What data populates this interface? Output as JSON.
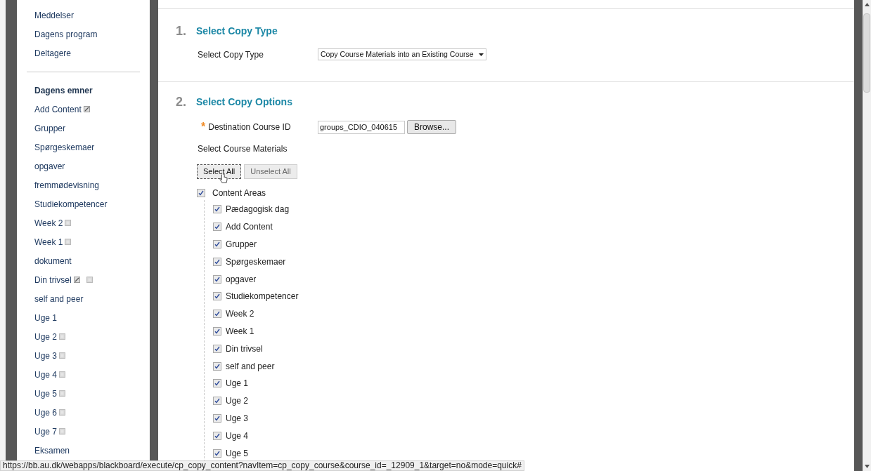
{
  "sidebar": {
    "top_items": [
      "Meddelser",
      "Dagens program",
      "Deltagere"
    ],
    "items": [
      {
        "label": "Dagens emner",
        "selected": true
      },
      {
        "label": "Add Content",
        "selected": false,
        "editable": true
      },
      {
        "label": "Grupper",
        "selected": false
      },
      {
        "label": "Spørgeskemaer",
        "selected": false
      },
      {
        "label": "opgaver",
        "selected": false
      },
      {
        "label": "fremmødevisning",
        "selected": false
      },
      {
        "label": "Studiekompetencer",
        "selected": false
      },
      {
        "label": "Week 2",
        "selected": false,
        "hidden": true
      },
      {
        "label": "Week 1",
        "selected": false,
        "hidden": true
      },
      {
        "label": "dokument",
        "selected": false
      },
      {
        "label": "Din trivsel",
        "selected": false,
        "editable": true,
        "hidden": true
      },
      {
        "label": "self and peer",
        "selected": false
      },
      {
        "label": "Uge 1",
        "selected": false
      },
      {
        "label": "Uge 2",
        "selected": false,
        "hidden": true
      },
      {
        "label": "Uge 3",
        "selected": false,
        "hidden": true
      },
      {
        "label": "Uge 4",
        "selected": false,
        "hidden": true
      },
      {
        "label": "Uge 5",
        "selected": false,
        "hidden": true
      },
      {
        "label": "Uge 6",
        "selected": false,
        "hidden": true
      },
      {
        "label": "Uge 7",
        "selected": false,
        "hidden": true
      },
      {
        "label": "Eksamen",
        "selected": false
      }
    ]
  },
  "sections": [
    {
      "number": "1.",
      "title": "Select Copy Type",
      "label": "Select Copy Type",
      "select_value": "Copy Course Materials into an Existing Course"
    },
    {
      "number": "2.",
      "title": "Select Copy Options",
      "required_mark": "*",
      "dest_label": "Destination Course ID",
      "dest_value": "groups_CDIO_040615",
      "browse": "Browse...",
      "materials_label": "Select Course Materials",
      "select_all": "Select All",
      "unselect_all": "Unselect All",
      "tree": {
        "label": "Content Areas",
        "checked": true,
        "children": [
          {
            "label": "Pædagogisk dag",
            "checked": true
          },
          {
            "label": "Add Content",
            "checked": true
          },
          {
            "label": "Grupper",
            "checked": true
          },
          {
            "label": "Spørgeskemaer",
            "checked": true
          },
          {
            "label": "opgaver",
            "checked": true
          },
          {
            "label": "Studiekompetencer",
            "checked": true
          },
          {
            "label": "Week 2",
            "checked": true
          },
          {
            "label": "Week 1",
            "checked": true
          },
          {
            "label": "Din trivsel",
            "checked": true
          },
          {
            "label": "self and peer",
            "checked": true
          },
          {
            "label": "Uge 1",
            "checked": true
          },
          {
            "label": "Uge 2",
            "checked": true
          },
          {
            "label": "Uge 3",
            "checked": true
          },
          {
            "label": "Uge 4",
            "checked": true
          },
          {
            "label": "Uge 5",
            "checked": true
          }
        ]
      }
    }
  ],
  "status_bar": "https://bb.au.dk/webapps/blackboard/execute/cp_copy_content?navItem=cp_copy_course&course_id=_12909_1&target=no&mode=quick#"
}
